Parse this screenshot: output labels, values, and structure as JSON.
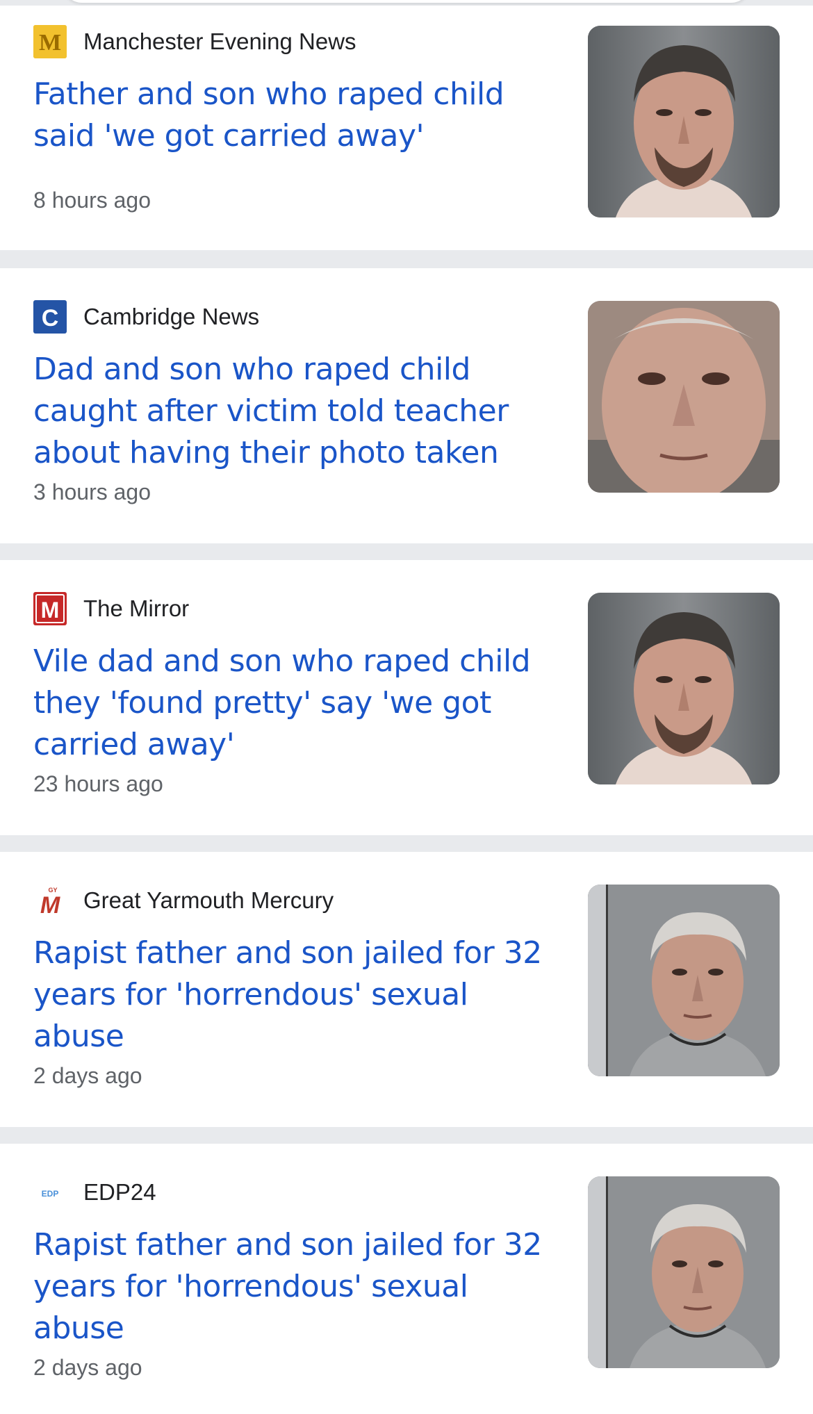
{
  "articles": [
    {
      "source": "Manchester Evening News",
      "source_icon": "manchester-evening-news-logo",
      "icon_color": "#f2c12e",
      "icon_glyph": "M",
      "headline": "Father and son who raped child said 'we got carried away'",
      "time": "8 hours ago"
    },
    {
      "source": "Cambridge News",
      "source_icon": "cambridge-news-logo",
      "icon_color": "#2454a6",
      "icon_glyph": "C",
      "headline": "Dad and son who raped child caught after victim told teacher about having their photo taken",
      "time": "3 hours ago"
    },
    {
      "source": "The Mirror",
      "source_icon": "the-mirror-logo",
      "icon_color": "#c62828",
      "icon_glyph": "M",
      "headline": "Vile dad and son who raped child they 'found pretty' say 'we got carried away'",
      "time": "23 hours ago"
    },
    {
      "source": "Great Yarmouth Mercury",
      "source_icon": "great-yarmouth-mercury-logo",
      "icon_color": "#c0392b",
      "icon_glyph": "M",
      "headline": "Rapist father and son jailed for 32 years for 'horrendous' sexual abuse",
      "time": "2 days ago"
    },
    {
      "source": "EDP24",
      "source_icon": "edp24-logo",
      "icon_color": "#4a90d9",
      "icon_glyph": "EDP",
      "headline": "Rapist father and son jailed for 32 years for 'horrendous' sexual abuse",
      "time": "2 days ago"
    }
  ],
  "colors": {
    "headline": "#1a55c8",
    "timestamp": "#5f6368",
    "separator": "#e8eaed"
  }
}
